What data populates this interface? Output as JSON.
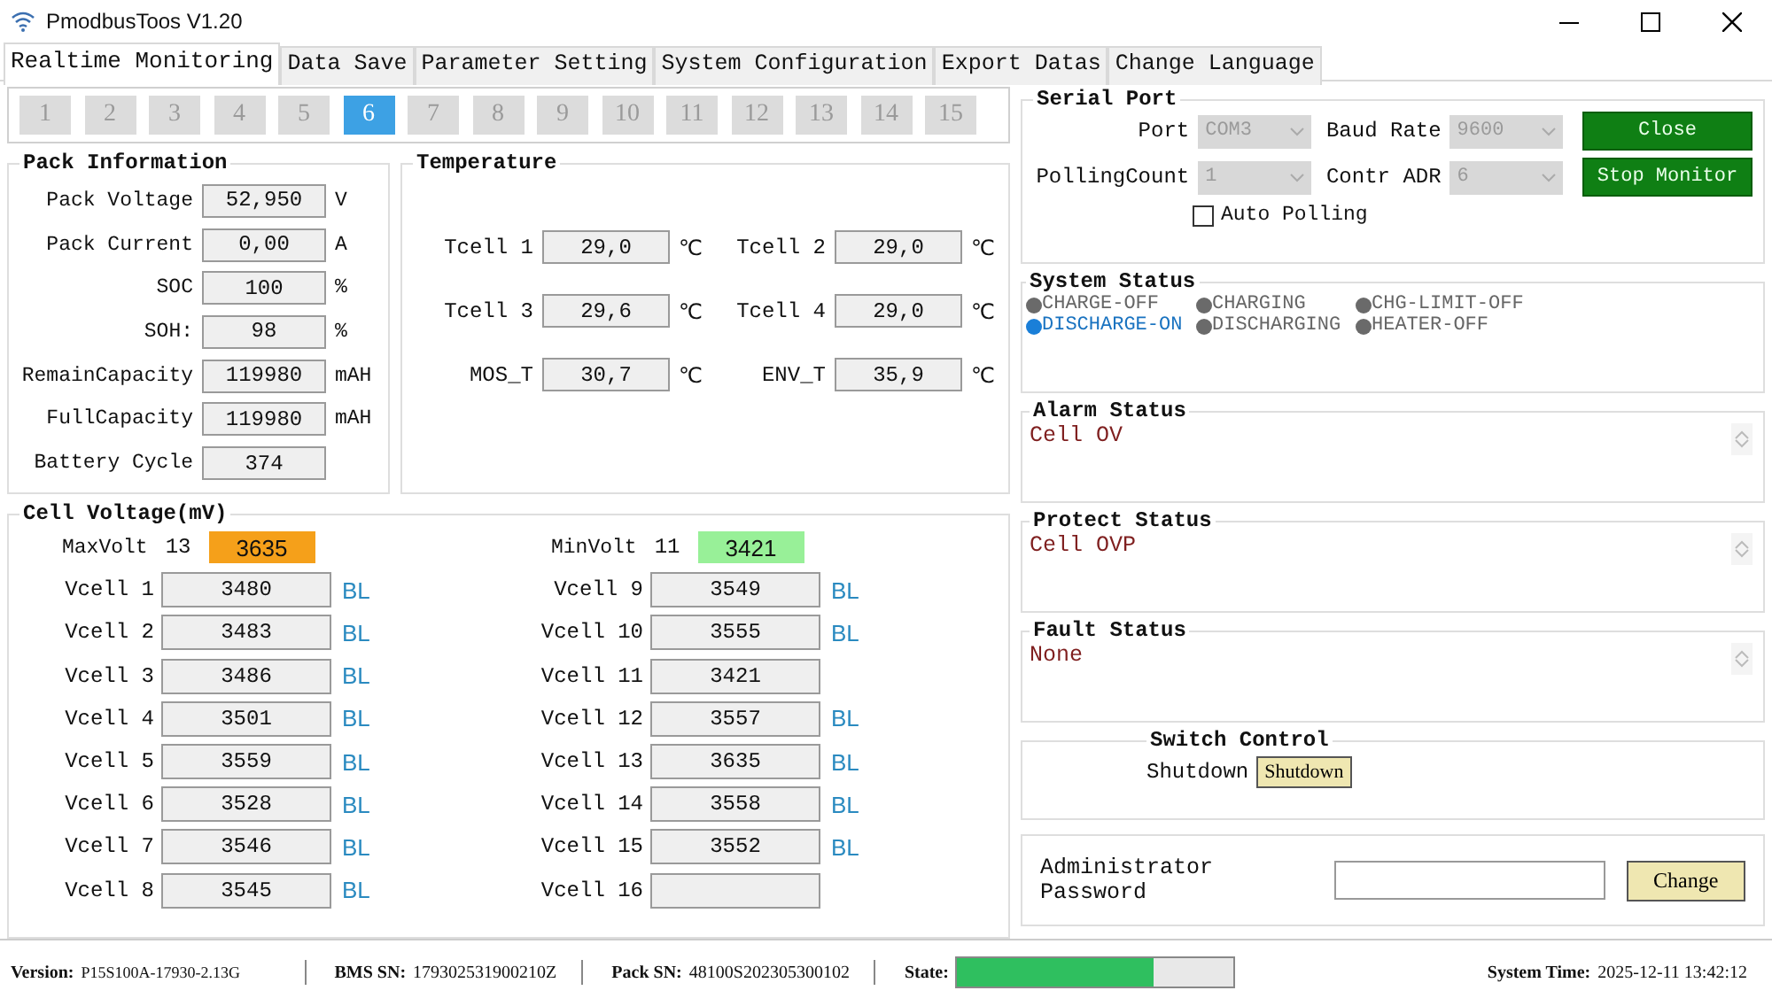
{
  "window": {
    "title": "PmodbusToos V1.20"
  },
  "tabs": [
    {
      "label": "Realtime Monitoring",
      "selected": true
    },
    {
      "label": "Data Save",
      "selected": false
    },
    {
      "label": "Parameter Setting",
      "selected": false
    },
    {
      "label": "System Configuration",
      "selected": false
    },
    {
      "label": "Export Datas",
      "selected": false
    },
    {
      "label": "Change Language",
      "selected": false
    }
  ],
  "pack_pages": [
    {
      "label": "1",
      "selected": false
    },
    {
      "label": "2",
      "selected": false
    },
    {
      "label": "3",
      "selected": false
    },
    {
      "label": "4",
      "selected": false
    },
    {
      "label": "5",
      "selected": false
    },
    {
      "label": "6",
      "selected": true
    },
    {
      "label": "7",
      "selected": false
    },
    {
      "label": "8",
      "selected": false
    },
    {
      "label": "9",
      "selected": false
    },
    {
      "label": "10",
      "selected": false
    },
    {
      "label": "11",
      "selected": false
    },
    {
      "label": "12",
      "selected": false
    },
    {
      "label": "13",
      "selected": false
    },
    {
      "label": "14",
      "selected": false
    },
    {
      "label": "15",
      "selected": false
    }
  ],
  "pack_information": {
    "title": "Pack Information",
    "rows": [
      {
        "label": "Pack Voltage",
        "value": "52,950",
        "unit": "V"
      },
      {
        "label": "Pack Current",
        "value": "0,00",
        "unit": "A"
      },
      {
        "label": "SOC",
        "value": "100",
        "unit": "%"
      },
      {
        "label": "SOH:",
        "value": "98",
        "unit": "%"
      },
      {
        "label": "RemainCapacity",
        "value": "119980",
        "unit": "mAH"
      },
      {
        "label": "FullCapacity",
        "value": "119980",
        "unit": "mAH"
      },
      {
        "label": "Battery Cycle",
        "value": "374"
      }
    ]
  },
  "temperature": {
    "title": "Temperature",
    "rows": [
      {
        "label": "Tcell 1",
        "value": "29,0",
        "unit": "℃"
      },
      {
        "label": "Tcell 2",
        "value": "29,0",
        "unit": "℃"
      },
      {
        "label": "Tcell 3",
        "value": "29,6",
        "unit": "℃"
      },
      {
        "label": "Tcell 4",
        "value": "29,0",
        "unit": "℃"
      },
      {
        "label": "MOS_T",
        "value": "30,7",
        "unit": "℃"
      },
      {
        "label": "ENV_T",
        "value": "35,9",
        "unit": "℃"
      }
    ]
  },
  "cell_voltage": {
    "title": "Cell Voltage(mV)",
    "extremes": [
      {
        "label": "MaxVolt",
        "cell": "13",
        "value": "3635",
        "color": "#f5a01a"
      },
      {
        "label": "MinVolt",
        "cell": "11",
        "value": "3421",
        "color": "#98f098"
      }
    ],
    "cells": [
      {
        "label": "Vcell 1",
        "value": "3480",
        "flag": "BL"
      },
      {
        "label": "Vcell 2",
        "value": "3483",
        "flag": "BL"
      },
      {
        "label": "Vcell 3",
        "value": "3486",
        "flag": "BL"
      },
      {
        "label": "Vcell 4",
        "value": "3501",
        "flag": "BL"
      },
      {
        "label": "Vcell 5",
        "value": "3559",
        "flag": "BL"
      },
      {
        "label": "Vcell 6",
        "value": "3528",
        "flag": "BL"
      },
      {
        "label": "Vcell 7",
        "value": "3546",
        "flag": "BL"
      },
      {
        "label": "Vcell 8",
        "value": "3545",
        "flag": "BL"
      },
      {
        "label": "Vcell 9",
        "value": "3549",
        "flag": "BL"
      },
      {
        "label": "Vcell 10",
        "value": "3555",
        "flag": "BL"
      },
      {
        "label": "Vcell 11",
        "value": "3421"
      },
      {
        "label": "Vcell 12",
        "value": "3557",
        "flag": "BL"
      },
      {
        "label": "Vcell 13",
        "value": "3635",
        "flag": "BL"
      },
      {
        "label": "Vcell 14",
        "value": "3558",
        "flag": "BL"
      },
      {
        "label": "Vcell 15",
        "value": "3552",
        "flag": "BL"
      },
      {
        "label": "Vcell 16"
      }
    ]
  },
  "serial_port": {
    "title": "Serial Port",
    "selects": [
      {
        "label": "Port",
        "value": "COM3"
      },
      {
        "label": "Baud Rate",
        "value": "9600"
      },
      {
        "label": "PollingCount",
        "value": "1"
      },
      {
        "label": "Contr ADR",
        "value": "6"
      }
    ],
    "buttons": [
      "Close",
      "Stop Monitor"
    ],
    "auto_polling": {
      "label": "Auto Polling",
      "checked": false
    }
  },
  "system_status": {
    "title": "System Status",
    "indicators": [
      {
        "label": "CHARGE-OFF",
        "on": false
      },
      {
        "label": "CHARGING",
        "on": false
      },
      {
        "label": "CHG-LIMIT-OFF",
        "on": false
      },
      {
        "label": "DISCHARGE-ON",
        "on": true
      },
      {
        "label": "DISCHARGING",
        "on": false
      },
      {
        "label": "HEATER-OFF",
        "on": false
      }
    ]
  },
  "messages": [
    {
      "title": "Alarm Status",
      "text": "Cell OV"
    },
    {
      "title": "Protect Status",
      "text": "Cell OVP"
    },
    {
      "title": "Fault Status",
      "text": "None"
    }
  ],
  "switch_control": {
    "title": "Switch Control",
    "label": "Shutdown",
    "button": "Shutdown"
  },
  "admin": {
    "label": "Administrator Password",
    "button": "Change"
  },
  "status_bar": {
    "version": {
      "label": "Version:",
      "value": "P15S100A-17930-2.13G"
    },
    "bms_sn": {
      "label": "BMS SN:",
      "value": "179302531900210Z"
    },
    "pack_sn": {
      "label": "Pack SN:",
      "value": "48100S202305300102"
    },
    "state": {
      "label": "State:",
      "level": 0.71
    },
    "system_time": {
      "label": "System Time:",
      "value": "2025-12-11 13:42:12"
    }
  }
}
